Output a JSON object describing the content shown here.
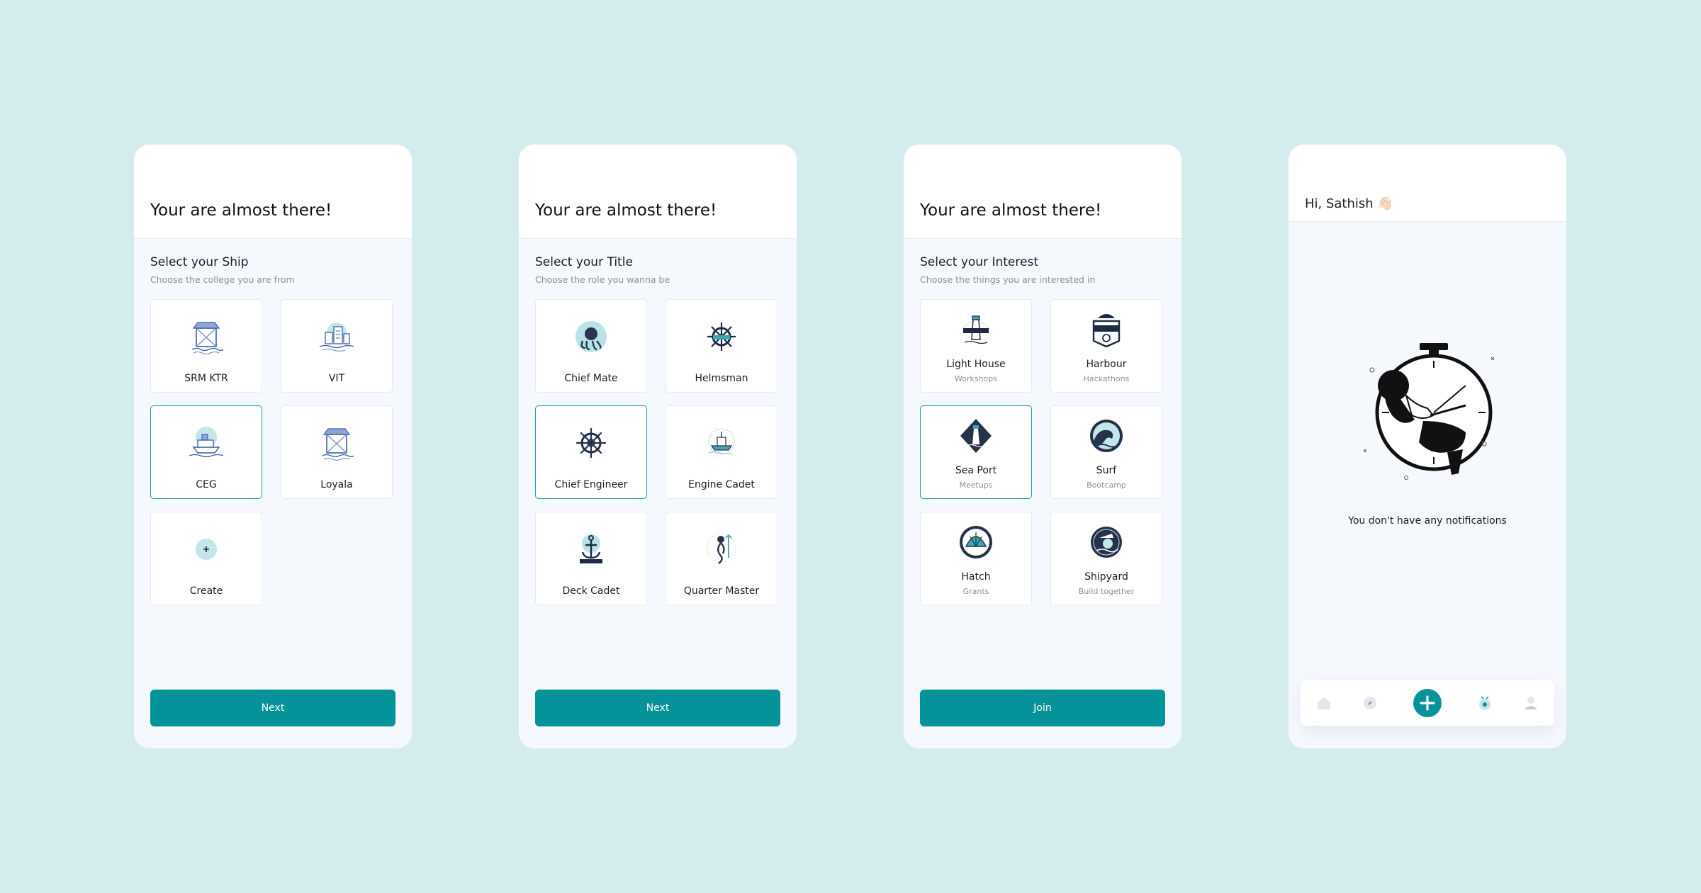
{
  "colors": {
    "background": "#d5ecef",
    "accent": "#05939a",
    "card_border_selected": "#1c9aa0"
  },
  "ship_screen": {
    "heading": "Your are almost there!",
    "section_title": "Select your Ship",
    "section_subtitle": "Choose the college you are from",
    "options": [
      {
        "label": "SRM KTR",
        "icon": "harbor-crane-icon"
      },
      {
        "label": "VIT",
        "icon": "city-waterfront-icon"
      },
      {
        "label": "CEG",
        "icon": "ship-icon",
        "selected": true
      },
      {
        "label": "Loyala",
        "icon": "harbor-crane-icon"
      },
      {
        "label": "Create",
        "icon": "plus-icon"
      }
    ],
    "button": "Next"
  },
  "title_screen": {
    "heading": "Your are almost there!",
    "section_title": "Select your Title",
    "section_subtitle": "Choose the role you wanna be",
    "options": [
      {
        "label": "Chief Mate",
        "icon": "octopus-badge-icon"
      },
      {
        "label": "Helmsman",
        "icon": "helm-badge-icon"
      },
      {
        "label": "Chief Engineer",
        "icon": "ship-wheel-icon",
        "selected": true
      },
      {
        "label": "Engine Cadet",
        "icon": "ship-emblem-icon"
      },
      {
        "label": "Deck Cadet",
        "icon": "anchor-badge-icon"
      },
      {
        "label": "Quarter Master",
        "icon": "mermaid-badge-icon"
      }
    ],
    "button": "Next"
  },
  "interest_screen": {
    "heading": "Your are almost there!",
    "section_title": "Select your Interest",
    "section_subtitle": "Choose the things you are interested in",
    "options": [
      {
        "label": "Light House",
        "sub": "Workshops",
        "icon": "lighthouse-badge-icon"
      },
      {
        "label": "Harbour",
        "sub": "Hackathons",
        "icon": "seafarer-badge-icon"
      },
      {
        "label": "Sea Port",
        "sub": "Meetups",
        "icon": "lighthouse-diamond-icon",
        "selected": true
      },
      {
        "label": "Surf",
        "sub": "Bootcamp",
        "icon": "wave-badge-icon"
      },
      {
        "label": "Hatch",
        "sub": "Grants",
        "icon": "shell-badge-icon"
      },
      {
        "label": "Shipyard",
        "sub": "Build together",
        "icon": "sailor-badge-icon"
      }
    ],
    "button": "Join"
  },
  "notifications_screen": {
    "greeting": "Hi, Sathish 👋🏻",
    "empty_message": "You don't have any notifications",
    "nav": [
      {
        "name": "home",
        "icon": "home-icon"
      },
      {
        "name": "explore",
        "icon": "compass-icon"
      },
      {
        "name": "create",
        "icon": "plus-circle-icon"
      },
      {
        "name": "notifications",
        "icon": "bell-badge-icon"
      },
      {
        "name": "profile",
        "icon": "user-icon"
      }
    ]
  }
}
